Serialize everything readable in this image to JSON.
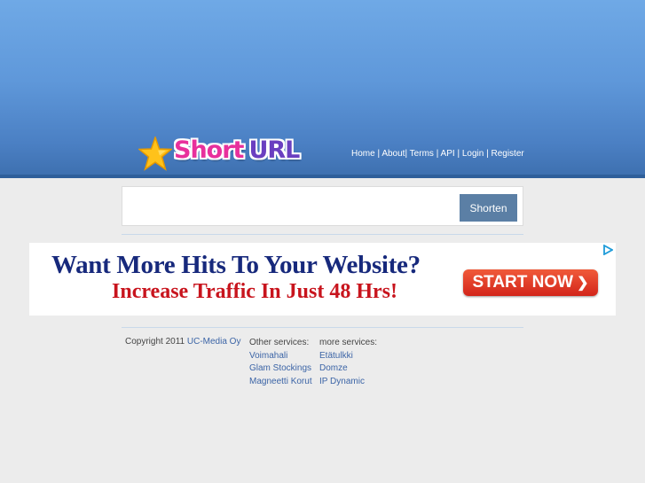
{
  "header": {
    "logo": {
      "word1": "Short",
      "word2": "URL"
    },
    "nav": [
      {
        "label": "Home"
      },
      {
        "label": "About"
      },
      {
        "label": "Terms"
      },
      {
        "label": "API"
      },
      {
        "label": "Login"
      },
      {
        "label": "Register"
      }
    ]
  },
  "shortener": {
    "input_value": "",
    "button_label": "Shorten"
  },
  "ad": {
    "headline": "Want More Hits To Your Website?",
    "subline": "Increase Traffic In Just 48 Hrs!",
    "cta": "START NOW",
    "choice_icon": "adchoices-icon"
  },
  "footer": {
    "copyright": "Copyright 2011",
    "company": "UC-Media Oy",
    "other_services": {
      "heading": "Other services:",
      "links": [
        "Voimahali",
        "Glam Stockings",
        "Magneetti Korut"
      ]
    },
    "more_services": {
      "heading": "more services:",
      "links": [
        "Etätulkki",
        "Domze",
        "IP Dynamic"
      ]
    }
  },
  "colors": {
    "header_top": "#6fa9e6",
    "header_bottom": "#3d6fae",
    "button": "#5b7fa5",
    "link": "#3b64a6",
    "ad_cta": "#d3251a"
  }
}
